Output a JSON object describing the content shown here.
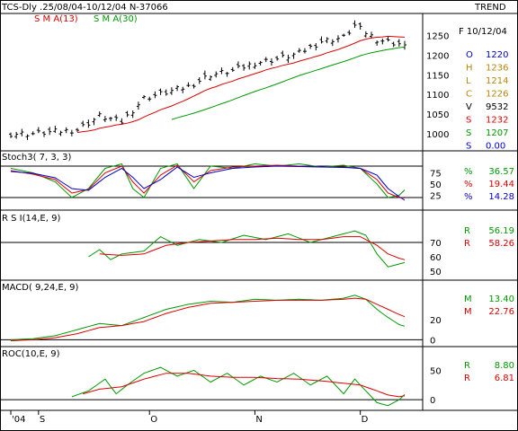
{
  "header": {
    "title": "TCS-Dly .25/08/04-10/12/04  N-37066",
    "trend": "TREND",
    "sma13_label": "S M A(13)",
    "sma30_label": "S M A(30)"
  },
  "info": {
    "date": "F 10/12/04",
    "rows": [
      {
        "key": "O",
        "value": "1220",
        "color": "#0000cc"
      },
      {
        "key": "H",
        "value": "1236",
        "color": "#b8860b"
      },
      {
        "key": "L",
        "value": "1214",
        "color": "#b8860b"
      },
      {
        "key": "C",
        "value": "1226",
        "color": "#b8860b"
      },
      {
        "key": "V",
        "value": "9532",
        "color": "#000000"
      },
      {
        "key": "S",
        "value": "1232",
        "color": "#dd0000"
      },
      {
        "key": "S",
        "value": "1207",
        "color": "#009900"
      },
      {
        "key": "S",
        "value": "0.00",
        "color": "#0000cc"
      }
    ]
  },
  "colors": {
    "sma13": "#dd0000",
    "sma30": "#009900",
    "price": "#000000",
    "stoch_k": "#009900",
    "stoch_d": "#dd0000",
    "stoch_3": "#0000cc",
    "rsi": "#009900",
    "rsi_signal": "#dd0000",
    "macd": "#009900",
    "macd_signal": "#dd0000",
    "roc": "#009900",
    "roc_signal": "#dd0000"
  },
  "chart_data": [
    {
      "type": "ohlc",
      "panel": "price",
      "title": "TCS-Dly .25/08/04-10/12/04  N-37066",
      "ylim": [
        970,
        1290
      ],
      "yticks": [
        1000,
        1050,
        1100,
        1150,
        1200,
        1250
      ],
      "x_labels": [
        {
          "label": "'04",
          "index": 0
        },
        {
          "label": "S",
          "index": 5
        },
        {
          "label": "O",
          "index": 25
        },
        {
          "label": "N",
          "index": 44
        },
        {
          "label": "D",
          "index": 63
        }
      ],
      "num_points": 72,
      "anchors": [
        [
          0,
          1000
        ],
        [
          4,
          1000
        ],
        [
          8,
          1005
        ],
        [
          12,
          1010
        ],
        [
          16,
          1045
        ],
        [
          20,
          1030
        ],
        [
          24,
          1090
        ],
        [
          28,
          1105
        ],
        [
          32,
          1120
        ],
        [
          36,
          1150
        ],
        [
          40,
          1160
        ],
        [
          44,
          1180
        ],
        [
          48,
          1190
        ],
        [
          52,
          1205
        ],
        [
          56,
          1235
        ],
        [
          60,
          1245
        ],
        [
          62,
          1275
        ],
        [
          66,
          1240
        ],
        [
          71,
          1226
        ]
      ],
      "last_bar": {
        "open": 1220,
        "high": 1236,
        "low": 1214,
        "close": 1226
      },
      "series": [
        {
          "name": "S M A(13)",
          "last": 1232
        },
        {
          "name": "S M A(30)",
          "last": 1207
        }
      ]
    },
    {
      "type": "line",
      "panel": "stoch",
      "title": "Stoch3( 7, 3, 3)",
      "ylim": [
        0,
        100
      ],
      "yticks": [
        25,
        50,
        75
      ],
      "reference_lines": [
        20,
        90
      ],
      "series": [
        {
          "name": "%",
          "last": 36.57,
          "anchors": [
            [
              0,
              85
            ],
            [
              4,
              75
            ],
            [
              8,
              55
            ],
            [
              11,
              20
            ],
            [
              14,
              40
            ],
            [
              17,
              85
            ],
            [
              20,
              95
            ],
            [
              22,
              40
            ],
            [
              24,
              20
            ],
            [
              27,
              85
            ],
            [
              30,
              95
            ],
            [
              33,
              40
            ],
            [
              36,
              90
            ],
            [
              40,
              85
            ],
            [
              44,
              95
            ],
            [
              48,
              90
            ],
            [
              52,
              95
            ],
            [
              56,
              88
            ],
            [
              60,
              92
            ],
            [
              63,
              85
            ],
            [
              66,
              50
            ],
            [
              68,
              20
            ],
            [
              70,
              25
            ],
            [
              71,
              37
            ]
          ]
        },
        {
          "name": "%",
          "last": 19.44,
          "anchors": [
            [
              0,
              80
            ],
            [
              4,
              72
            ],
            [
              8,
              60
            ],
            [
              11,
              30
            ],
            [
              14,
              38
            ],
            [
              17,
              75
            ],
            [
              20,
              90
            ],
            [
              22,
              55
            ],
            [
              24,
              30
            ],
            [
              27,
              70
            ],
            [
              30,
              92
            ],
            [
              33,
              55
            ],
            [
              36,
              80
            ],
            [
              40,
              88
            ],
            [
              44,
              90
            ],
            [
              48,
              92
            ],
            [
              52,
              90
            ],
            [
              56,
              88
            ],
            [
              60,
              88
            ],
            [
              63,
              85
            ],
            [
              66,
              60
            ],
            [
              68,
              30
            ],
            [
              70,
              20
            ],
            [
              71,
              19
            ]
          ]
        },
        {
          "name": "%",
          "last": 14.28,
          "anchors": [
            [
              0,
              78
            ],
            [
              4,
              74
            ],
            [
              8,
              64
            ],
            [
              11,
              40
            ],
            [
              14,
              36
            ],
            [
              17,
              65
            ],
            [
              20,
              85
            ],
            [
              22,
              65
            ],
            [
              24,
              40
            ],
            [
              27,
              60
            ],
            [
              30,
              88
            ],
            [
              33,
              65
            ],
            [
              36,
              75
            ],
            [
              40,
              85
            ],
            [
              44,
              88
            ],
            [
              48,
              90
            ],
            [
              52,
              89
            ],
            [
              56,
              88
            ],
            [
              60,
              87
            ],
            [
              63,
              85
            ],
            [
              66,
              70
            ],
            [
              68,
              40
            ],
            [
              70,
              22
            ],
            [
              71,
              14
            ]
          ]
        }
      ]
    },
    {
      "type": "line",
      "panel": "rsi",
      "title": "R S I(14,E, 9)",
      "ylim": [
        45,
        85
      ],
      "yticks": [
        50,
        60,
        70
      ],
      "reference_lines": [
        70
      ],
      "series": [
        {
          "name": "R",
          "last": 56.19,
          "start": 14,
          "anchors": [
            [
              14,
              60
            ],
            [
              16,
              65
            ],
            [
              18,
              58
            ],
            [
              20,
              62
            ],
            [
              24,
              64
            ],
            [
              27,
              74
            ],
            [
              30,
              68
            ],
            [
              34,
              72
            ],
            [
              38,
              70
            ],
            [
              42,
              75
            ],
            [
              46,
              72
            ],
            [
              50,
              76
            ],
            [
              54,
              70
            ],
            [
              58,
              74
            ],
            [
              62,
              78
            ],
            [
              64,
              75
            ],
            [
              66,
              62
            ],
            [
              68,
              53
            ],
            [
              70,
              55
            ],
            [
              71,
              56
            ]
          ]
        },
        {
          "name": "R",
          "last": 58.26,
          "start": 16,
          "anchors": [
            [
              16,
              62
            ],
            [
              20,
              61
            ],
            [
              24,
              62
            ],
            [
              28,
              68
            ],
            [
              32,
              70
            ],
            [
              36,
              71
            ],
            [
              40,
              72
            ],
            [
              44,
              72
            ],
            [
              48,
              73
            ],
            [
              52,
              72
            ],
            [
              56,
              72
            ],
            [
              60,
              74
            ],
            [
              63,
              74
            ],
            [
              66,
              68
            ],
            [
              68,
              62
            ],
            [
              70,
              59
            ],
            [
              71,
              58
            ]
          ]
        }
      ]
    },
    {
      "type": "line",
      "panel": "macd",
      "title": "MACD( 9,24,E, 9)",
      "ylim": [
        -5,
        50
      ],
      "yticks": [
        0,
        20
      ],
      "reference_lines": [
        0
      ],
      "series": [
        {
          "name": "M",
          "last": 13.4,
          "anchors": [
            [
              0,
              0
            ],
            [
              4,
              1
            ],
            [
              8,
              4
            ],
            [
              12,
              10
            ],
            [
              16,
              16
            ],
            [
              20,
              14
            ],
            [
              24,
              22
            ],
            [
              28,
              30
            ],
            [
              32,
              35
            ],
            [
              36,
              38
            ],
            [
              40,
              37
            ],
            [
              44,
              40
            ],
            [
              48,
              39
            ],
            [
              52,
              40
            ],
            [
              56,
              39
            ],
            [
              60,
              41
            ],
            [
              62,
              44
            ],
            [
              64,
              40
            ],
            [
              66,
              30
            ],
            [
              68,
              22
            ],
            [
              70,
              15
            ],
            [
              71,
              13.4
            ]
          ]
        },
        {
          "name": "M",
          "last": 22.76,
          "anchors": [
            [
              0,
              -1
            ],
            [
              4,
              0
            ],
            [
              8,
              2
            ],
            [
              12,
              6
            ],
            [
              16,
              12
            ],
            [
              20,
              14
            ],
            [
              24,
              18
            ],
            [
              28,
              26
            ],
            [
              32,
              32
            ],
            [
              36,
              36
            ],
            [
              40,
              37
            ],
            [
              44,
              38
            ],
            [
              48,
              39
            ],
            [
              52,
              39
            ],
            [
              56,
              39
            ],
            [
              60,
              40
            ],
            [
              62,
              41
            ],
            [
              64,
              40
            ],
            [
              66,
              35
            ],
            [
              68,
              30
            ],
            [
              70,
              25
            ],
            [
              71,
              22.8
            ]
          ]
        }
      ]
    },
    {
      "type": "line",
      "panel": "roc",
      "title": "ROC(10,E, 9)",
      "ylim": [
        -15,
        75
      ],
      "yticks": [
        0,
        50
      ],
      "reference_lines": [
        0
      ],
      "series": [
        {
          "name": "R",
          "last": 8.8,
          "start": 11,
          "anchors": [
            [
              11,
              5
            ],
            [
              14,
              15
            ],
            [
              17,
              35
            ],
            [
              19,
              10
            ],
            [
              21,
              25
            ],
            [
              24,
              45
            ],
            [
              27,
              55
            ],
            [
              30,
              40
            ],
            [
              33,
              50
            ],
            [
              36,
              30
            ],
            [
              39,
              45
            ],
            [
              42,
              25
            ],
            [
              45,
              40
            ],
            [
              48,
              30
            ],
            [
              51,
              45
            ],
            [
              54,
              25
            ],
            [
              57,
              40
            ],
            [
              60,
              10
            ],
            [
              62,
              35
            ],
            [
              64,
              15
            ],
            [
              66,
              -5
            ],
            [
              68,
              -10
            ],
            [
              70,
              0
            ],
            [
              71,
              8.8
            ]
          ]
        },
        {
          "name": "R",
          "last": 6.81,
          "start": 13,
          "anchors": [
            [
              13,
              10
            ],
            [
              16,
              18
            ],
            [
              20,
              22
            ],
            [
              24,
              35
            ],
            [
              28,
              45
            ],
            [
              32,
              45
            ],
            [
              36,
              40
            ],
            [
              40,
              38
            ],
            [
              44,
              38
            ],
            [
              48,
              36
            ],
            [
              52,
              35
            ],
            [
              56,
              32
            ],
            [
              60,
              28
            ],
            [
              63,
              25
            ],
            [
              66,
              15
            ],
            [
              68,
              8
            ],
            [
              70,
              5
            ],
            [
              71,
              6.8
            ]
          ]
        }
      ]
    }
  ]
}
